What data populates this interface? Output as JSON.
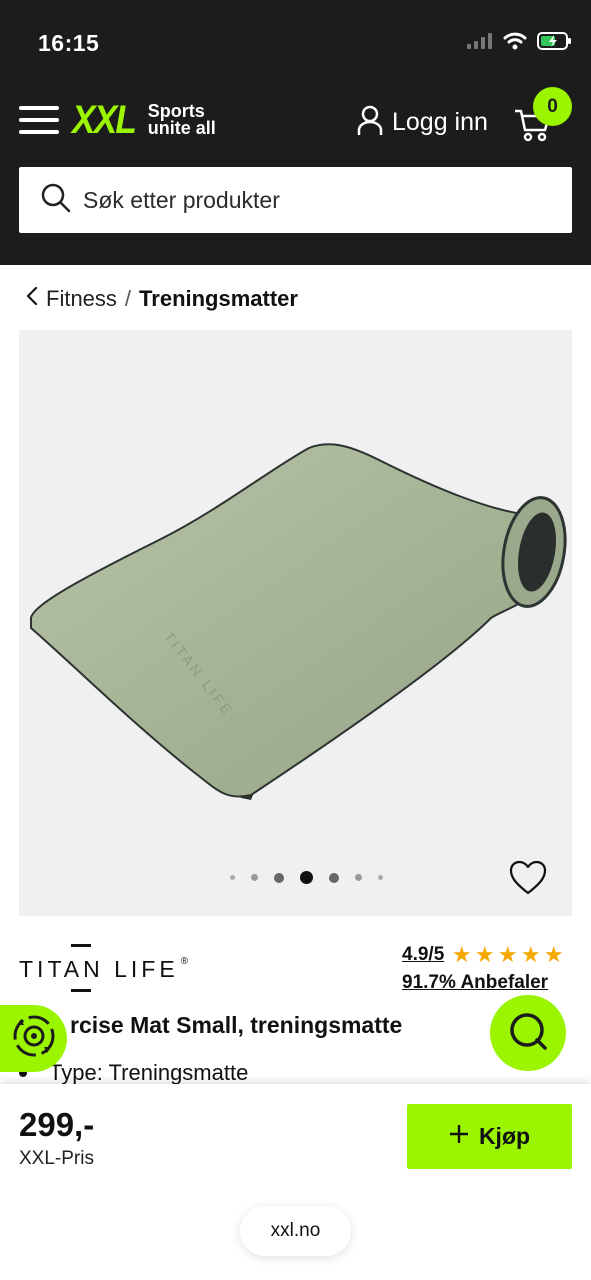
{
  "status_bar": {
    "time": "16:15"
  },
  "header": {
    "logo_main": "XXL",
    "logo_tagline_1": "Sports",
    "logo_tagline_2": "unite all",
    "login_label": "Logg inn",
    "cart_count": "0"
  },
  "search": {
    "placeholder": "Søk etter produkter"
  },
  "breadcrumb": {
    "parent": "Fitness",
    "separator": "/",
    "current": "Treningsmatter"
  },
  "gallery": {
    "dots_count": 7,
    "active_index": 3
  },
  "product": {
    "brand": "TITAN LIFE",
    "brand_mark": "®",
    "rating": "4.9/5",
    "stars": 5,
    "recommend": "91.7% Anbefaler",
    "title": "rcise Mat Small, treningsmatte",
    "bullet": "Type: Treningsmatte"
  },
  "purchase": {
    "price": "299,-",
    "price_label": "XXL-Pris",
    "buy_label": "Kjøp"
  },
  "browser": {
    "url": "xxl.no"
  },
  "colors": {
    "accent": "#9bf500",
    "header_bg": "#1c1c1c",
    "star": "#f5a800",
    "mat_green": "#a9b89a"
  },
  "icons": [
    "menu-icon",
    "user-icon",
    "cart-icon",
    "search-icon",
    "chevron-left-icon",
    "heart-icon",
    "recycle-icon",
    "chat-icon",
    "plus-icon",
    "signal-icon",
    "wifi-icon",
    "battery-icon"
  ]
}
